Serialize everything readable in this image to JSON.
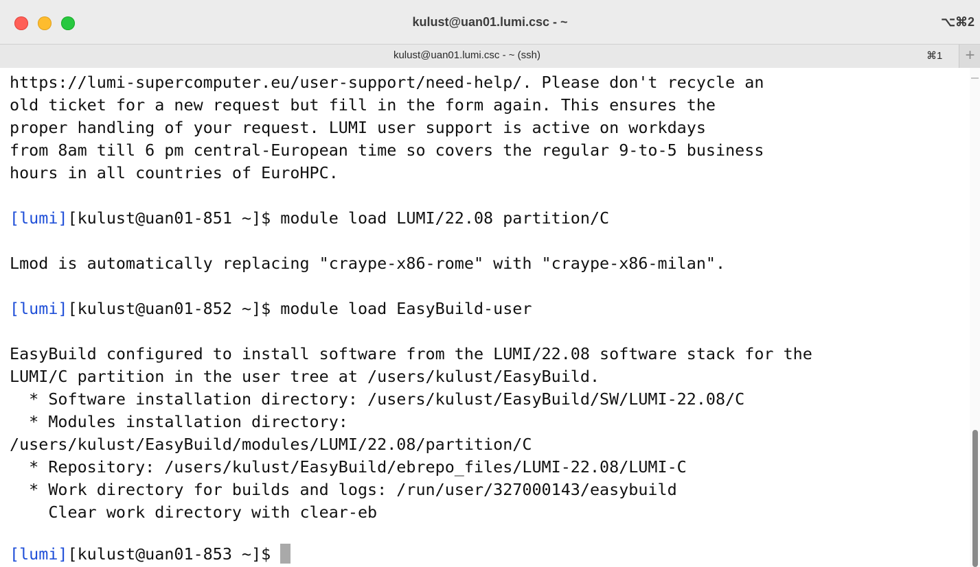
{
  "window": {
    "title": "kulust@uan01.lumi.csc - ~",
    "shortcut": "⌥⌘2"
  },
  "tab": {
    "label": "kulust@uan01.lumi.csc - ~ (ssh)",
    "shortcut": "⌘1",
    "new_tab_symbol": "+"
  },
  "terminal": {
    "lines": {
      "l0": "https://lumi-supercomputer.eu/user-support/need-help/. Please don't recycle an",
      "l1": "old ticket for a new request but fill in the form again. This ensures the",
      "l2": "proper handling of your request. LUMI user support is active on workdays",
      "l3": "from 8am till 6 pm central-European time so covers the regular 9-to-5 business",
      "l4": "hours in all countries of EuroHPC.",
      "l6_tag": "[lumi]",
      "l6_rest": "[kulust@uan01-851 ~]$ module load LUMI/22.08 partition/C",
      "l8": "Lmod is automatically replacing \"craype-x86-rome\" with \"craype-x86-milan\".",
      "l10_tag": "[lumi]",
      "l10_rest": "[kulust@uan01-852 ~]$ module load EasyBuild-user",
      "l12": "EasyBuild configured to install software from the LUMI/22.08 software stack for the",
      "l13": "LUMI/C partition in the user tree at /users/kulust/EasyBuild.",
      "l14": "  * Software installation directory: /users/kulust/EasyBuild/SW/LUMI-22.08/C",
      "l15": "  * Modules installation directory:",
      "l16": "/users/kulust/EasyBuild/modules/LUMI/22.08/partition/C",
      "l17": "  * Repository: /users/kulust/EasyBuild/ebrepo_files/LUMI-22.08/LUMI-C",
      "l18": "  * Work directory for builds and logs: /run/user/327000143/easybuild",
      "l19": "    Clear work directory with clear-eb",
      "l21_tag": "[lumi]",
      "l21_rest": "[kulust@uan01-853 ~]$ "
    }
  },
  "colors": {
    "prompt_tag": "#1f4fd8",
    "close": "#ff5f57",
    "minimize": "#febc2e",
    "maximize": "#28c840"
  }
}
